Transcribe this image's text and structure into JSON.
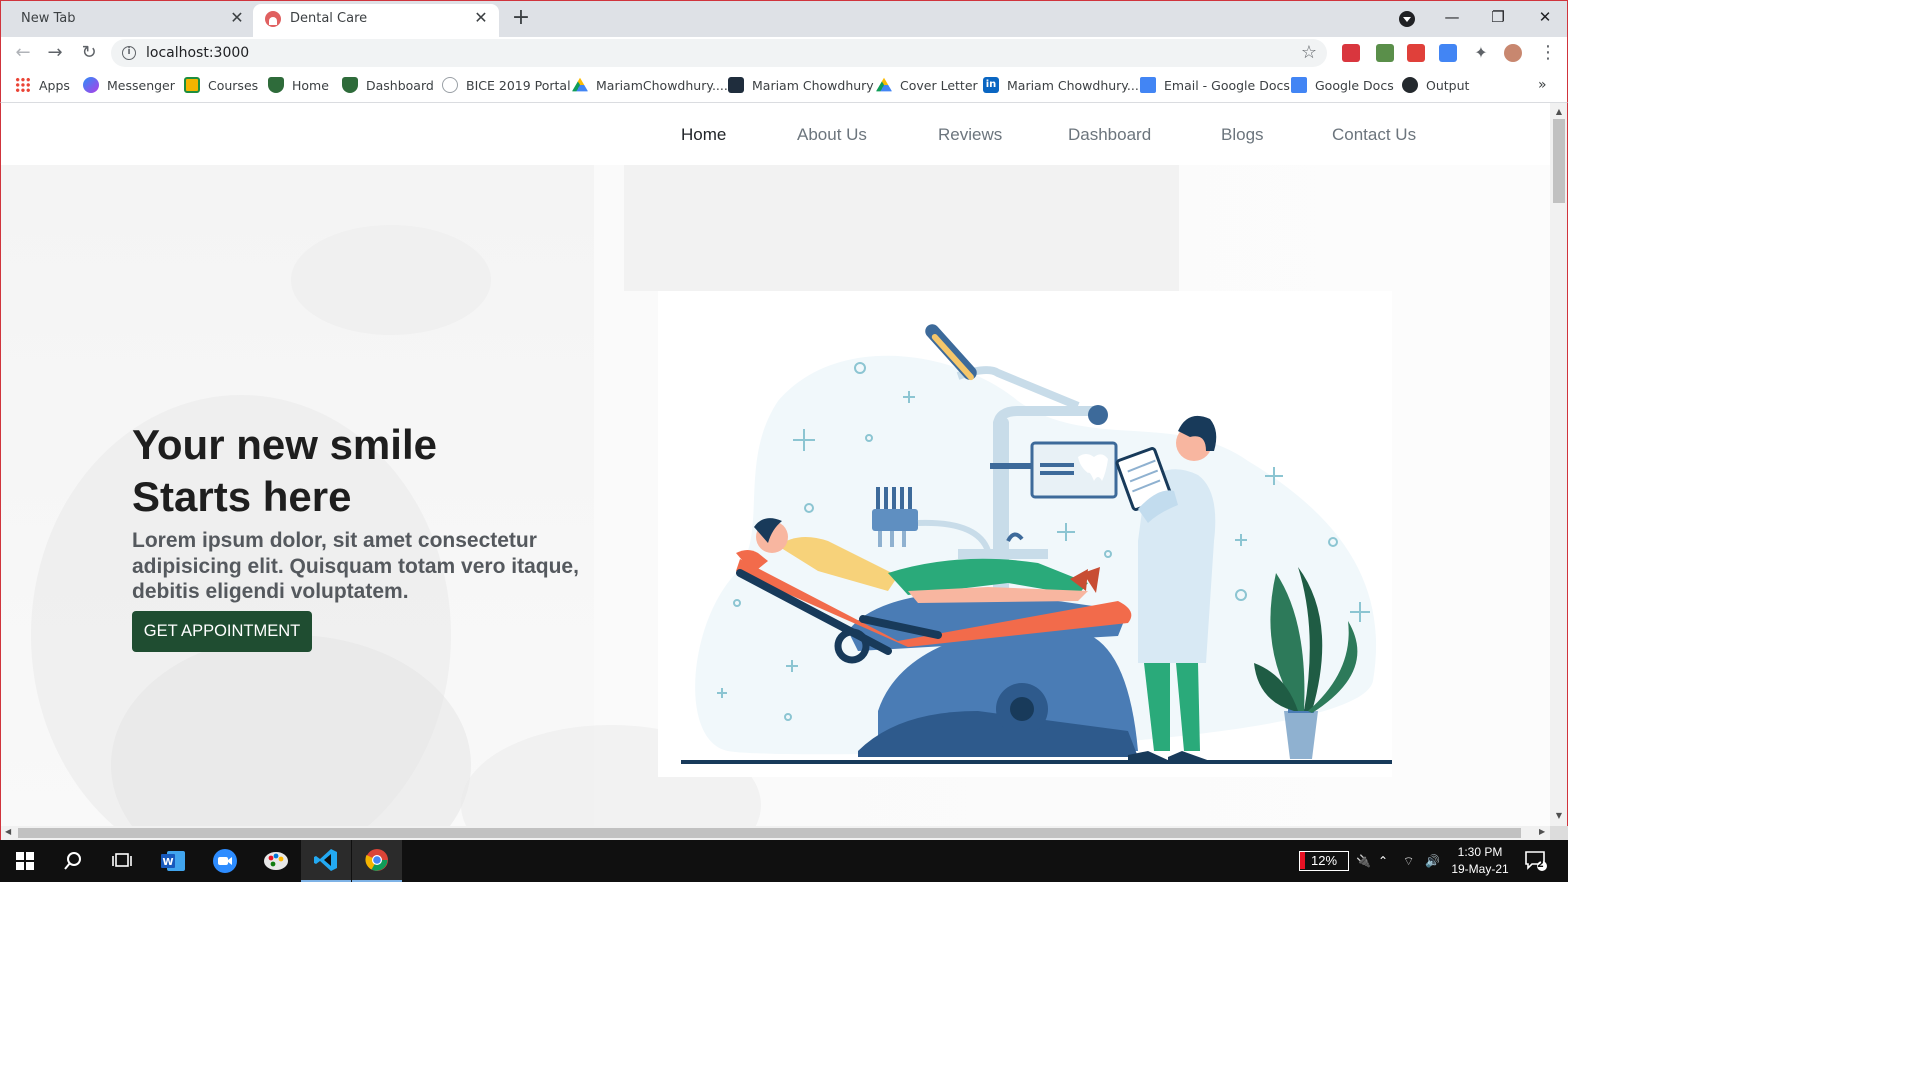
{
  "browser": {
    "tabs": [
      {
        "title": "New Tab",
        "active": false
      },
      {
        "title": "Dental Care",
        "active": true
      }
    ],
    "new_tab_label": "+",
    "address": "localhost:3000",
    "bookmarks": [
      {
        "label": "Apps",
        "icon": "apps-grid-icon",
        "color": "#ea4335"
      },
      {
        "label": "Messenger",
        "icon": "messenger-icon",
        "color": "#7b3fe4"
      },
      {
        "label": "Courses",
        "icon": "classroom-icon",
        "color": "#f4b400"
      },
      {
        "label": "Home",
        "icon": "shield-icon",
        "color": "#2e6b3a"
      },
      {
        "label": "Dashboard",
        "icon": "shield-icon",
        "color": "#2e6b3a"
      },
      {
        "label": "BICE 2019 Portal",
        "icon": "globe-icon",
        "color": "#9aa0a6"
      },
      {
        "label": "MariamChowdhury....",
        "icon": "google-drive-icon",
        "color": "#34a853"
      },
      {
        "label": "Mariam Chowdhury",
        "icon": "react-icon",
        "color": "#1f2d3d"
      },
      {
        "label": "Cover Letter",
        "icon": "google-drive-icon",
        "color": "#fbbc04"
      },
      {
        "label": "Mariam Chowdhury...",
        "icon": "linkedin-icon",
        "color": "#0a66c2"
      },
      {
        "label": "Email - Google Docs",
        "icon": "google-docs-icon",
        "color": "#4285f4"
      },
      {
        "label": "Google Docs",
        "icon": "google-docs-icon",
        "color": "#4285f4"
      },
      {
        "label": "Output",
        "icon": "github-icon",
        "color": "#24292e"
      }
    ],
    "bookmarks_more": "»"
  },
  "site": {
    "nav": [
      "Home",
      "About Us",
      "Reviews",
      "Dashboard",
      "Blogs",
      "Contact Us"
    ],
    "active_nav": "Home",
    "hero": {
      "headline_line1": "Your new smile",
      "headline_line2": "Starts here",
      "subtext": "Lorem ipsum dolor, sit amet consectetur adipisicing elit. Quisquam totam vero itaque, debitis eligendi voluptatem.",
      "cta_label": "GET APPOINTMENT"
    },
    "illustration": "dentist-with-patient-illustration"
  },
  "taskbar": {
    "apps": [
      "start-icon",
      "search-icon",
      "task-view-icon",
      "word-icon",
      "zoom-icon",
      "paint-icon",
      "vscode-icon",
      "chrome-icon"
    ],
    "battery_percent": "12%",
    "time": "1:30 PM",
    "date": "19-May-21",
    "notification_count": "2"
  },
  "colors": {
    "cta_bg": "#1f4d31",
    "accent_orange": "#f26b4b",
    "accent_blue": "#4a7cb5",
    "accent_green": "#2aaa7a"
  }
}
